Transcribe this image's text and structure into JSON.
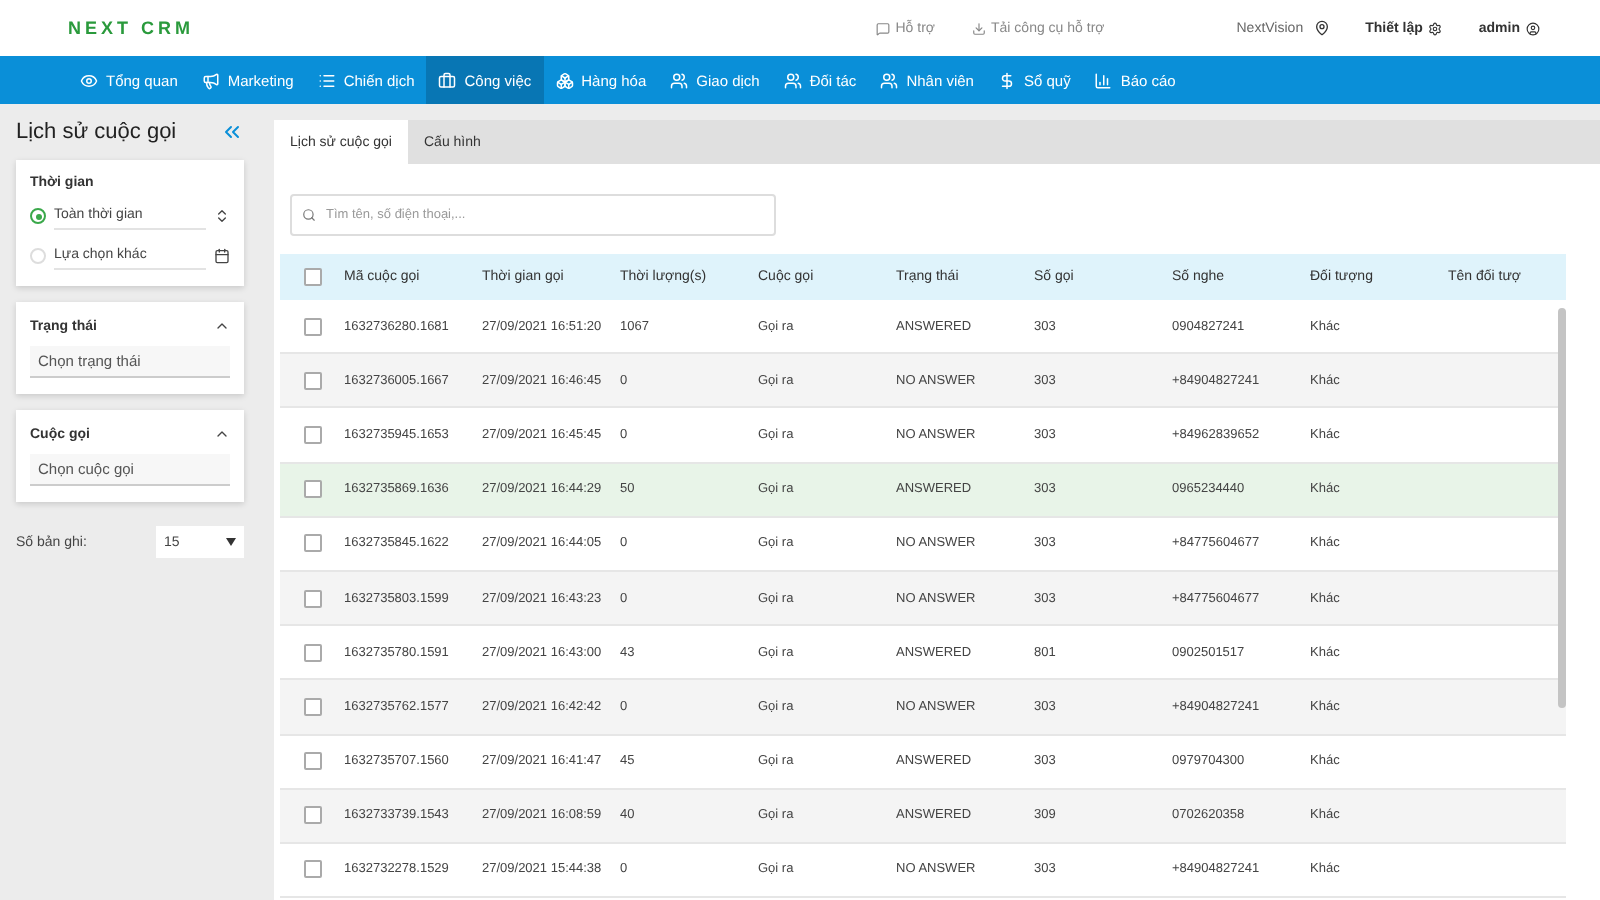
{
  "header": {
    "logo": "NEXT CRM",
    "links": [
      {
        "label": "Hỗ trợ"
      },
      {
        "label": "Tải công cụ hỗ trợ"
      }
    ],
    "org": "NextVision",
    "settings": "Thiết lập",
    "user": "admin"
  },
  "nav": [
    {
      "label": "Tổng quan",
      "selected": false
    },
    {
      "label": "Marketing",
      "selected": false
    },
    {
      "label": "Chiến dịch",
      "selected": false
    },
    {
      "label": "Công việc",
      "selected": true
    },
    {
      "label": "Hàng hóa",
      "selected": false
    },
    {
      "label": "Giao dịch",
      "selected": false
    },
    {
      "label": "Đối tác",
      "selected": false
    },
    {
      "label": "Nhân viên",
      "selected": false
    },
    {
      "label": "Sổ quỹ",
      "selected": false
    },
    {
      "label": "Báo cáo",
      "selected": false
    }
  ],
  "sidebar": {
    "title": "Lịch sử cuộc gọi",
    "time_filter": {
      "title": "Thời gian",
      "options": [
        {
          "label": "Toàn thời gian",
          "selected": true
        },
        {
          "label": "Lựa chọn khác",
          "selected": false
        }
      ]
    },
    "filters": [
      {
        "title": "Trạng thái",
        "placeholder": "Chọn trạng thái",
        "expanded": true
      },
      {
        "title": "Cuộc gọi",
        "placeholder": "Chọn cuộc gọi",
        "expanded": true
      }
    ],
    "page_size": {
      "label": "Số bản ghi:",
      "value": "15"
    }
  },
  "tabs": [
    {
      "label": "Lịch sử cuộc gọi",
      "selected": true
    },
    {
      "label": "Cấu hình",
      "selected": false
    }
  ],
  "search": {
    "placeholder": "Tìm tên, số điện thoại,..."
  },
  "table": {
    "all_checked": false,
    "columns": [
      "Mã cuộc gọi",
      "Thời gian gọi",
      "Thời lượng(s)",
      "Cuộc gọi",
      "Trạng thái",
      "Số gọi",
      "Số nghe",
      "Đối tượng",
      "Tên đối tượ"
    ],
    "rows": [
      {
        "checked": false,
        "highlighted": false,
        "cells": [
          "1632736280.1681",
          "27/09/2021 16:51:20",
          "1067",
          "Gọi ra",
          "ANSWERED",
          "303",
          "0904827241",
          "Khác"
        ]
      },
      {
        "checked": false,
        "highlighted": false,
        "cells": [
          "1632736005.1667",
          "27/09/2021 16:46:45",
          "0",
          "Gọi ra",
          "NO ANSWER",
          "303",
          "+84904827241",
          "Khác"
        ]
      },
      {
        "checked": false,
        "highlighted": false,
        "cells": [
          "1632735945.1653",
          "27/09/2021 16:45:45",
          "0",
          "Gọi ra",
          "NO ANSWER",
          "303",
          "+84962839652",
          "Khác"
        ]
      },
      {
        "checked": false,
        "highlighted": true,
        "cells": [
          "1632735869.1636",
          "27/09/2021 16:44:29",
          "50",
          "Gọi ra",
          "ANSWERED",
          "303",
          "0965234440",
          "Khác"
        ]
      },
      {
        "checked": false,
        "highlighted": false,
        "cells": [
          "1632735845.1622",
          "27/09/2021 16:44:05",
          "0",
          "Gọi ra",
          "NO ANSWER",
          "303",
          "+84775604677",
          "Khác"
        ]
      },
      {
        "checked": false,
        "highlighted": false,
        "cells": [
          "1632735803.1599",
          "27/09/2021 16:43:23",
          "0",
          "Gọi ra",
          "NO ANSWER",
          "303",
          "+84775604677",
          "Khác"
        ]
      },
      {
        "checked": false,
        "highlighted": false,
        "cells": [
          "1632735780.1591",
          "27/09/2021 16:43:00",
          "43",
          "Gọi ra",
          "ANSWERED",
          "801",
          "0902501517",
          "Khác"
        ]
      },
      {
        "checked": false,
        "highlighted": false,
        "cells": [
          "1632735762.1577",
          "27/09/2021 16:42:42",
          "0",
          "Gọi ra",
          "NO ANSWER",
          "303",
          "+84904827241",
          "Khác"
        ]
      },
      {
        "checked": false,
        "highlighted": false,
        "cells": [
          "1632735707.1560",
          "27/09/2021 16:41:47",
          "45",
          "Gọi ra",
          "ANSWERED",
          "303",
          "0979704300",
          "Khác"
        ]
      },
      {
        "checked": false,
        "highlighted": false,
        "cells": [
          "1632733739.1543",
          "27/09/2021 16:08:59",
          "40",
          "Gọi ra",
          "ANSWERED",
          "309",
          "0702620358",
          "Khác"
        ]
      },
      {
        "checked": false,
        "highlighted": false,
        "cells": [
          "1632732278.1529",
          "27/09/2021 15:44:38",
          "0",
          "Gọi ra",
          "NO ANSWER",
          "303",
          "+84904827241",
          "Khác"
        ]
      }
    ]
  }
}
